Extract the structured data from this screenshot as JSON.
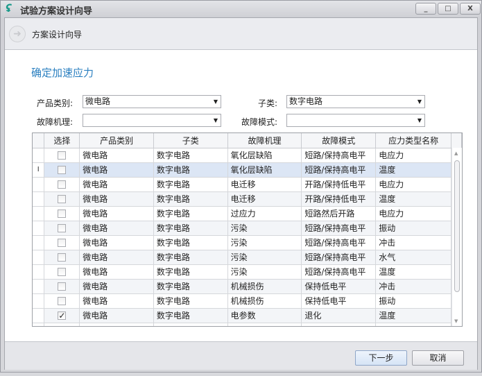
{
  "window": {
    "title": "试验方案设计向导",
    "minimize": "_",
    "maximize": "□",
    "close": "X"
  },
  "header": {
    "title": "方案设计向导",
    "back_icon": "arrow-left-icon"
  },
  "step_title": "确定加速应力",
  "form": {
    "product_category": {
      "label": "产品类别:",
      "value": "微电路"
    },
    "subclass": {
      "label": "子类:",
      "value": "数字电路"
    },
    "failure_mechanism": {
      "label": "故障机理:",
      "value": ""
    },
    "failure_mode": {
      "label": "故障模式:",
      "value": ""
    }
  },
  "table": {
    "columns": [
      "选择",
      "产品类别",
      "子类",
      "故障机理",
      "故障模式",
      "应力类型名称"
    ],
    "current_row_marker": "I",
    "rows": [
      {
        "checked": false,
        "c": [
          "微电路",
          "数字电路",
          "氧化层缺陷",
          "短路/保持高电平",
          "电应力"
        ]
      },
      {
        "checked": false,
        "c": [
          "微电路",
          "数字电路",
          "氧化层缺陷",
          "短路/保持高电平",
          "温度"
        ]
      },
      {
        "checked": false,
        "c": [
          "微电路",
          "数字电路",
          "电迁移",
          "开路/保持低电平",
          "电应力"
        ]
      },
      {
        "checked": false,
        "c": [
          "微电路",
          "数字电路",
          "电迁移",
          "开路/保持低电平",
          "温度"
        ]
      },
      {
        "checked": false,
        "c": [
          "微电路",
          "数字电路",
          "过应力",
          "短路然后开路",
          "电应力"
        ]
      },
      {
        "checked": false,
        "c": [
          "微电路",
          "数字电路",
          "污染",
          "短路/保持高电平",
          "振动"
        ]
      },
      {
        "checked": false,
        "c": [
          "微电路",
          "数字电路",
          "污染",
          "短路/保持高电平",
          "冲击"
        ]
      },
      {
        "checked": false,
        "c": [
          "微电路",
          "数字电路",
          "污染",
          "短路/保持高电平",
          "水气"
        ]
      },
      {
        "checked": false,
        "c": [
          "微电路",
          "数字电路",
          "污染",
          "短路/保持高电平",
          "温度"
        ]
      },
      {
        "checked": false,
        "c": [
          "微电路",
          "数字电路",
          "机械损伤",
          "保持低电平",
          "冲击"
        ]
      },
      {
        "checked": false,
        "c": [
          "微电路",
          "数字电路",
          "机械损伤",
          "保持低电平",
          "振动"
        ]
      },
      {
        "checked": true,
        "c": [
          "微电路",
          "数字电路",
          "电参数",
          "退化",
          "温度"
        ]
      }
    ]
  },
  "buttons": {
    "next": "下一步",
    "cancel": "取消"
  }
}
